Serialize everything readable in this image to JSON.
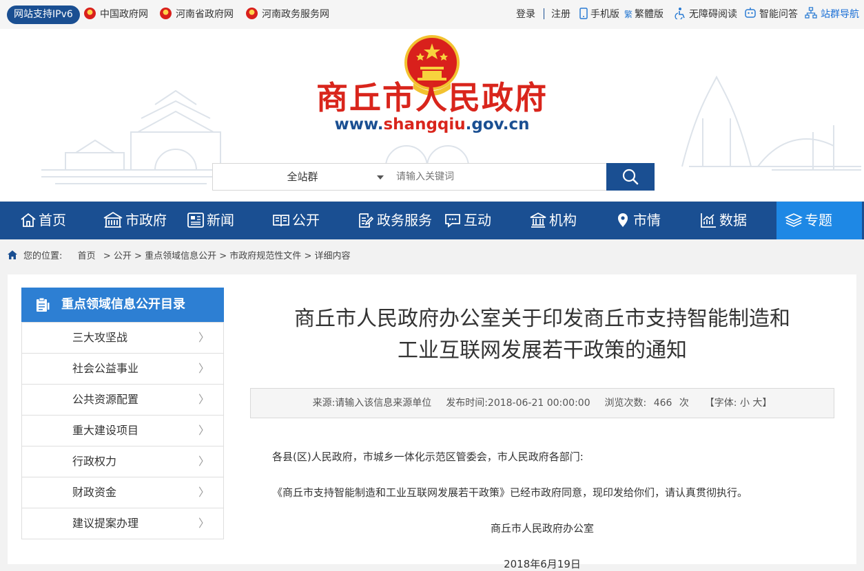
{
  "topbar": {
    "ipv6_badge": "网站支持IPv6",
    "links": [
      "中国政府网",
      "河南省政府网",
      "河南政务服务网"
    ],
    "right": {
      "login": "登录",
      "register": "注册",
      "mobile": "手机版",
      "traditional": "繁體版",
      "accessible": "无障碍阅读",
      "qa": "智能问答",
      "sitemap": "站群导航"
    }
  },
  "header": {
    "site_title": "商丘市人民政府",
    "url_prefix": "www.",
    "url_highlight": "shangqiu",
    "url_suffix": ".gov.cn",
    "search_scope": "全站群",
    "search_placeholder": "请输入关键词"
  },
  "nav": [
    "首页",
    "市政府",
    "新闻",
    "公开",
    "政务服务",
    "互动",
    "机构",
    "市情",
    "数据",
    "专题"
  ],
  "breadcrumb": {
    "label": "您的位置:",
    "items": [
      "首页",
      "公开",
      "重点领域信息公开",
      "市政府规范性文件",
      "详细内容"
    ],
    "separator": ">"
  },
  "sidebar": {
    "title": "重点领域信息公开目录",
    "items": [
      "三大攻坚战",
      "社会公益事业",
      "公共资源配置",
      "重大建设项目",
      "行政权力",
      "财政资金",
      "建议提案办理"
    ],
    "arrow": "〉"
  },
  "article": {
    "title_line1": "商丘市人民政府办公室关于印发商丘市支持智能制造和",
    "title_line2": "工业互联网发展若干政策的通知",
    "meta": {
      "source_label": "来源:",
      "source": "请输入该信息来源单位",
      "date_label": "发布时间:",
      "date": "2018-06-21 00:00:00",
      "views_label": "浏览次数:",
      "views": "466",
      "views_unit": "次",
      "font_label": "【字体:",
      "font_small": "小",
      "font_large": "大",
      "font_close": "】"
    },
    "salutation": "各县(区)人民政府，市城乡一体化示范区管委会，市人民政府各部门:",
    "body": "《商丘市支持智能制造和工业互联网发展若干政策》已经市政府同意，现印发给你们，请认真贯彻执行。",
    "signature": "商丘市人民政府办公室",
    "sign_date": "2018年6月19日"
  },
  "colors": {
    "brand_blue": "#1a4f92",
    "active_blue": "#1e88e5",
    "title_red": "#d9251c"
  }
}
